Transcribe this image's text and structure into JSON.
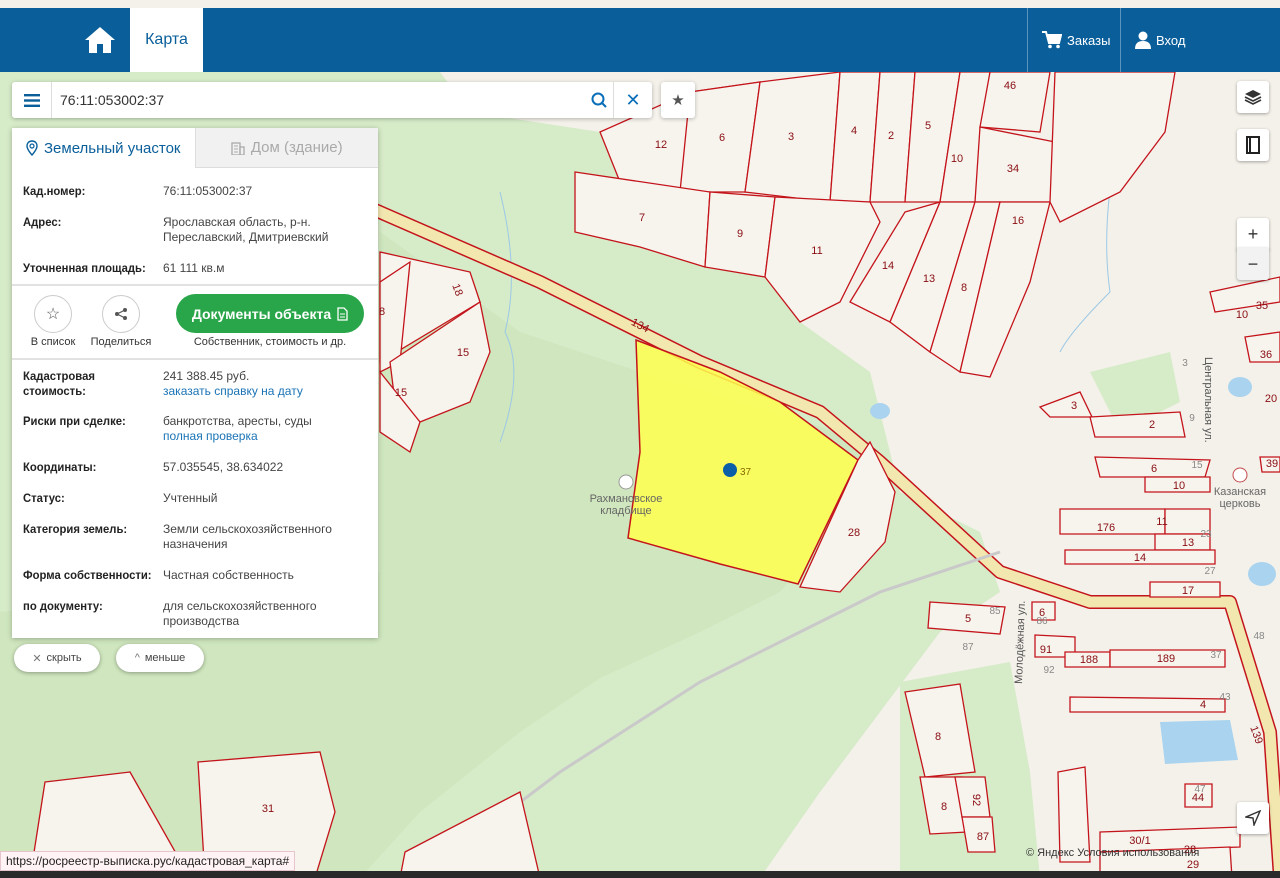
{
  "topbar": {
    "home_icon": "home-icon",
    "map_tab": "Карта",
    "orders": "Заказы",
    "login": "Вход"
  },
  "search": {
    "value": "76:11:053002:37",
    "menu_icon": "menu-icon",
    "search_icon": "search-icon",
    "clear_icon": "close-icon",
    "favorite_icon": "star-icon"
  },
  "panel": {
    "tabs": [
      {
        "label": "Земельный участок",
        "icon": "map-pin-icon"
      },
      {
        "label": "Дом (здание)",
        "icon": "building-icon"
      }
    ],
    "fields_top": [
      {
        "label": "Кад.номер:",
        "value": "76:11:053002:37",
        "is_link": true
      },
      {
        "label": "Адрес:",
        "value": "Ярославская область, р-н. Переславский, Дмитриевский"
      },
      {
        "label": "Уточненная площадь:",
        "value": "61 111 кв.м"
      }
    ],
    "actions": {
      "add_to_list": "В список",
      "share": "Поделиться",
      "docs_button": "Документы объекта",
      "docs_caption": "Собственник, стоимость и др."
    },
    "fields_bottom": [
      {
        "label": "Кадастровая стоимость:",
        "value": "241 388.45 руб.",
        "link": "заказать справку на дату"
      },
      {
        "label": "Риски при сделке:",
        "value": "банкротства, аресты, суды",
        "link": "полная проверка"
      },
      {
        "label": "Координаты:",
        "value": "57.035545, 38.634022"
      },
      {
        "label": "Статус:",
        "value": "Учтенный"
      },
      {
        "label": "Категория земель:",
        "value": "Земли сельскохозяйственного назначения"
      },
      {
        "label": "Форма собственности:",
        "value": "Частная собственность"
      },
      {
        "label": "по документу:",
        "value": "для сельскохозяйственного производства"
      }
    ]
  },
  "pills": {
    "hide": "скрыть",
    "less": "меньше"
  },
  "controls": {
    "zoom_in": "+",
    "zoom_out": "−",
    "layers_icon": "layers-icon",
    "book_icon": "book-icon",
    "locate_icon": "navigation-arrow-icon"
  },
  "map": {
    "road_number_a": "134",
    "road_number_b": "139",
    "selected_plot_number": "37",
    "cemetery_name_line1": "Рахмановское",
    "cemetery_name_line2": "кладбище",
    "church_name_line1": "Казанская",
    "church_name_line2": "церковь",
    "street_central": "Центральная ул.",
    "street_molodezhnaya": "Молодёжная ул.",
    "plot_labels": [
      "46",
      "12",
      "6",
      "3",
      "4",
      "2",
      "5",
      "10",
      "34",
      "7",
      "9",
      "11",
      "16",
      "14",
      "13",
      "8",
      "18",
      "8",
      "15",
      "15",
      "28",
      "3",
      "2",
      "6",
      "10",
      "176",
      "11",
      "13",
      "14",
      "17",
      "5",
      "6",
      "91",
      "188",
      "189",
      "4",
      "8",
      "8",
      "92",
      "87",
      "44",
      "30/1",
      "28",
      "29",
      "31",
      "39",
      "35",
      "36",
      "10",
      "20"
    ],
    "grey_labels": [
      "3",
      "9",
      "15",
      "23",
      "27",
      "85",
      "87",
      "92",
      "43",
      "47",
      "48",
      "37",
      "86"
    ]
  },
  "status_link": "https://росреестр-выписка.рус/кадастровая_карта#",
  "attribution": "© Яндекс Условия использования"
}
